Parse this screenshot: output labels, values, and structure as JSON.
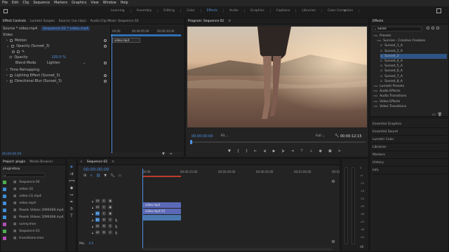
{
  "menubar": [
    "File",
    "Edit",
    "Clip",
    "Sequence",
    "Markers",
    "Graphics",
    "View",
    "Window",
    "Help"
  ],
  "workspaces": {
    "tabs": [
      "Learning",
      "Assembly",
      "Editing",
      "Color",
      "Effects",
      "Audio",
      "Graphics",
      "Captions",
      "Libraries",
      "Color Correction"
    ],
    "active": "Effects"
  },
  "effect_controls": {
    "tabs": [
      "Effect Controls",
      "Lumetri Scopes",
      "Source: (no clips)",
      "Audio Clip Mixer: Sequence 02"
    ],
    "source_label": "Source * video.mp4",
    "sequence_label": "Sequence 02 * video.mp4",
    "section": "Video",
    "rows": [
      {
        "label": "Motion"
      },
      {
        "label": "Opacity (Sunset_3)"
      },
      {
        "label": "Opacity",
        "value": "100.0 %"
      },
      {
        "label": "Blend Mode",
        "value": "Lighten"
      },
      {
        "label": "Time Remapping"
      },
      {
        "label": "Lighting Effect (Sunset_3)"
      },
      {
        "label": "Directional Blur (Sunset_3)"
      }
    ],
    "ruler": [
      "00:00",
      "00:00:05:00",
      "00:00:10:00"
    ],
    "clip_label": "video.mp4",
    "timecode": "00:00:00:00"
  },
  "program": {
    "title": "Program: Sequence 02",
    "timecode": "00:00:00:00",
    "fit": "Fit",
    "quality": "Full",
    "duration": "00:00:12:15"
  },
  "effects": {
    "title": "Effects",
    "search": "sunse",
    "items": [
      {
        "label": "Presets",
        "indent": 0
      },
      {
        "label": "Sunrise - Creative Freebies",
        "indent": 1
      },
      {
        "label": "Sunset_1_A",
        "indent": 2
      },
      {
        "label": "Sunset_2_A",
        "indent": 2
      },
      {
        "label": "Sunset_3",
        "indent": 2,
        "selected": true
      },
      {
        "label": "Sunset_4_A",
        "indent": 2
      },
      {
        "label": "Sunset_5_A",
        "indent": 2
      },
      {
        "label": "Sunset_6_A",
        "indent": 2
      },
      {
        "label": "Sunset_7_A",
        "indent": 2
      },
      {
        "label": "Sunset_8_A",
        "indent": 2
      },
      {
        "label": "Lumetri Presets",
        "indent": 0
      },
      {
        "label": "Audio Effects",
        "indent": 0
      },
      {
        "label": "Audio Transitions",
        "indent": 0
      },
      {
        "label": "Video Effects",
        "indent": 0
      },
      {
        "label": "Video Transitions",
        "indent": 0
      }
    ],
    "side_panels": [
      "Essential Graphics",
      "Essential Sound",
      "Lumetri Color",
      "Libraries",
      "Markers",
      "History",
      "Info"
    ]
  },
  "project": {
    "tabs": [
      "Project: plugin",
      "Media Browser"
    ],
    "name": "pluginsboy",
    "items": [
      {
        "name": "Sequence 02",
        "color": "#4caf50"
      },
      {
        "name": "video (2)",
        "color": "#3f8fd6"
      },
      {
        "name": "video (1).mp4",
        "color": "#3f8fd6"
      },
      {
        "name": "video.mp4",
        "color": "#3f8fd6"
      },
      {
        "name": "Pexels Videos 2099368.mp4",
        "color": "#3f8fd6"
      },
      {
        "name": "Pexels Videos 2099368.mp4",
        "color": "#3f8fd6"
      },
      {
        "name": "sunny.mov",
        "color": "#b04fb4"
      },
      {
        "name": "Sequence 01",
        "color": "#4caf50"
      },
      {
        "name": "transitions.mov",
        "color": "#b04fb4"
      }
    ]
  },
  "timeline": {
    "tab": "Sequence 02",
    "timecode": "00:00:00:00",
    "ruler": [
      "00:00",
      "00:00:15:00",
      "00:00:30:00",
      "00:00:45:00",
      "00:01:00:00",
      "00:01"
    ],
    "tracks": [
      {
        "name": "V3",
        "kind": "video"
      },
      {
        "name": "V2",
        "kind": "video"
      },
      {
        "name": "V1",
        "kind": "video"
      },
      {
        "name": "A1",
        "kind": "audio"
      },
      {
        "name": "A2",
        "kind": "audio"
      },
      {
        "name": "A3",
        "kind": "audio"
      }
    ],
    "clips": [
      {
        "label": "video.mp4",
        "color": "#5b69b8"
      },
      {
        "label": "video.mp4 [V]",
        "color": "#5b69b8"
      },
      {
        "label": "",
        "color": "#4a78b0"
      }
    ],
    "master_label": "Mix",
    "master_value": "0.0"
  },
  "audio_meter": {
    "scale": [
      "0",
      "-6",
      "-12",
      "-18",
      "-24",
      "-30",
      "-36",
      "-42",
      "-48",
      "-54"
    ],
    "unit": "dB"
  }
}
